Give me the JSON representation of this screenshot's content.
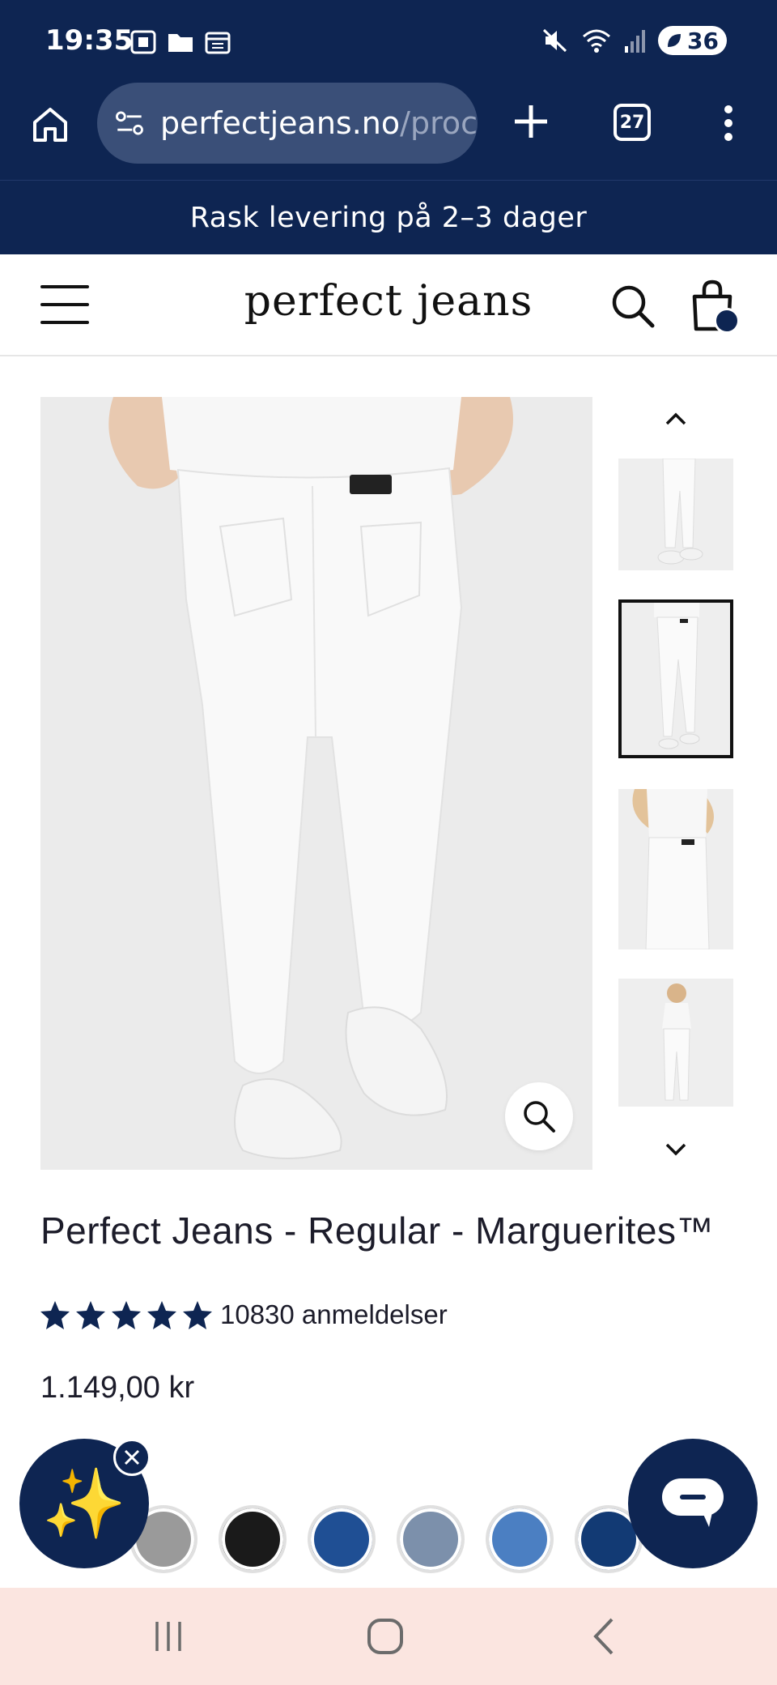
{
  "status_bar": {
    "time": "19:35",
    "battery": "36"
  },
  "browser": {
    "url_main": "perfectjeans.no",
    "url_rest": "/proc",
    "tab_count": "27"
  },
  "announcement": "Rask levering på 2–3 dager",
  "header": {
    "logo": "perfect jeans"
  },
  "product": {
    "title": "Perfect Jeans - Regular - Marguerites™",
    "rating": 5,
    "review_count": "10830 anmeldelser",
    "price": "1.149,00 kr"
  },
  "gallery": {
    "selected_index": 1,
    "thumbnail_count": 4
  },
  "swatches": [
    {
      "color": "#9a9a9a"
    },
    {
      "color": "#1a1a1a"
    },
    {
      "color": "#1f4f94"
    },
    {
      "color": "#7c90ab"
    },
    {
      "color": "#4b7fc2"
    },
    {
      "color": "#123a74"
    }
  ],
  "colors": {
    "brand_navy": "#0e2552",
    "nav_bar_bg": "#fbe5e0"
  },
  "icons": {
    "sparkles": "✨"
  }
}
